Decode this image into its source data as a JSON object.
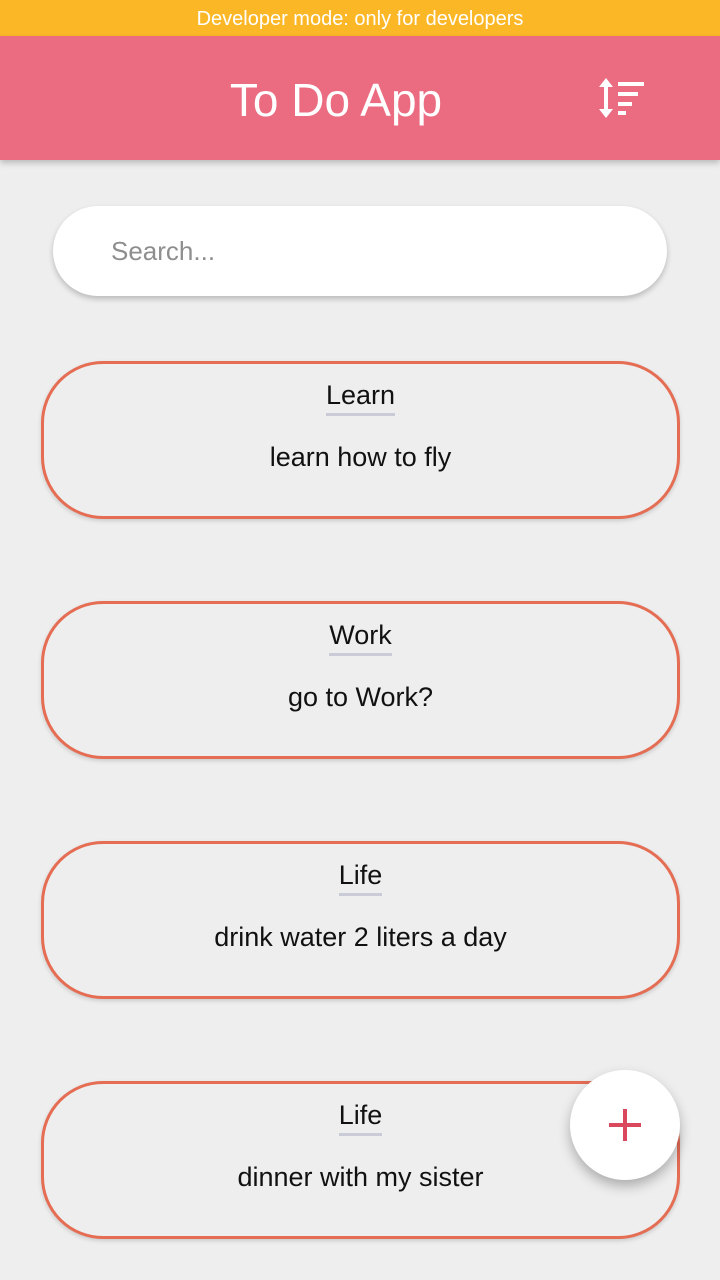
{
  "status_banner": {
    "text": "Developer mode: only for developers"
  },
  "app_bar": {
    "title": "To Do App",
    "sort_icon": "sort-icon"
  },
  "search": {
    "placeholder": "Search...",
    "value": ""
  },
  "todos": [
    {
      "category": "Learn",
      "text": "learn how to fly"
    },
    {
      "category": "Work",
      "text": "go to Work?"
    },
    {
      "category": "Life",
      "text": "drink water 2 liters a day"
    },
    {
      "category": "Life",
      "text": "dinner with my sister"
    }
  ],
  "fab": {
    "icon": "plus-icon"
  },
  "colors": {
    "banner": "#fbb726",
    "app_bar": "#eb6b80",
    "card_border": "#e46d54",
    "fab_plus": "#d9485c",
    "background": "#eeeeee"
  }
}
